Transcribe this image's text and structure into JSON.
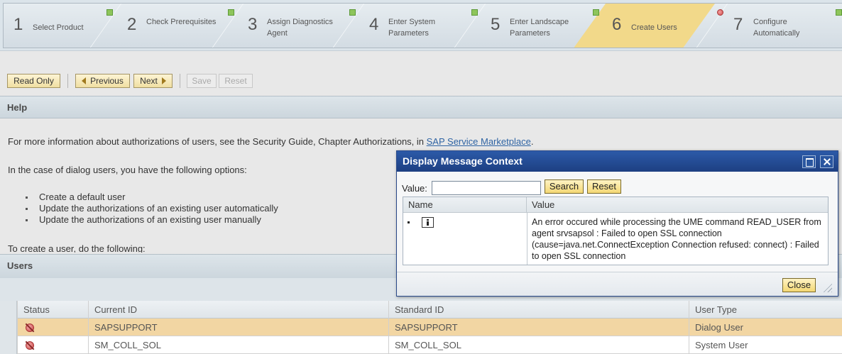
{
  "roadmap": {
    "steps": [
      {
        "num": "1",
        "label": "Select Product",
        "status": "none"
      },
      {
        "num": "2",
        "label": "Check Prerequisites",
        "status": "ok"
      },
      {
        "num": "3",
        "label": "Assign Diagnostics Agent",
        "status": "ok"
      },
      {
        "num": "4",
        "label": "Enter System Parameters",
        "status": "ok"
      },
      {
        "num": "5",
        "label": "Enter Landscape Parameters",
        "status": "ok"
      },
      {
        "num": "6",
        "label": "Create Users",
        "status": "error",
        "active": true
      },
      {
        "num": "7",
        "label": "Configure Automatically",
        "status": "ok"
      }
    ]
  },
  "toolbar": {
    "read_only": "Read Only",
    "previous": "Previous",
    "next": "Next",
    "save": "Save",
    "reset": "Reset"
  },
  "help": {
    "title": "Help",
    "line1_prefix": "For more information about authorizations of users, see the Security Guide, Chapter Authorizations, in ",
    "line1_link": "SAP Service Marketplace",
    "line1_suffix": ".",
    "line2": "In the case of dialog users, you have the following options:",
    "options": [
      "Create a default user",
      "Update the authorizations of an existing user automatically",
      "Update the authorizations of an existing user manually"
    ],
    "line3": "To create a user, do the following:"
  },
  "users": {
    "title": "Users",
    "columns": [
      "Status",
      "Current ID",
      "Standard ID",
      "User Type"
    ],
    "rows": [
      {
        "status": "error",
        "current_id": "SAPSUPPORT",
        "standard_id": "SAPSUPPORT",
        "user_type": "Dialog User"
      },
      {
        "status": "error",
        "current_id": "SM_COLL_SOL",
        "standard_id": "SM_COLL_SOL",
        "user_type": "System User"
      }
    ]
  },
  "dialog": {
    "title": "Display Message Context",
    "value_label": "Value:",
    "value_input": "",
    "search": "Search",
    "reset": "Reset",
    "columns": [
      "Name",
      "Value"
    ],
    "message": "An error occured while processing the UME command READ_USER from agent srvsapsol : Failed to open SSL connection (cause=java.net.ConnectException Connection refused: connect) : Failed to open SSL connection",
    "close": "Close"
  },
  "colors": {
    "accent_selected_row": "#f2d6a3",
    "active_step": "#f2d98a",
    "dialog_title": "#1d3f82",
    "status_ok": "#8ec55b",
    "status_error": "#c94040",
    "link": "#2e63a3"
  }
}
